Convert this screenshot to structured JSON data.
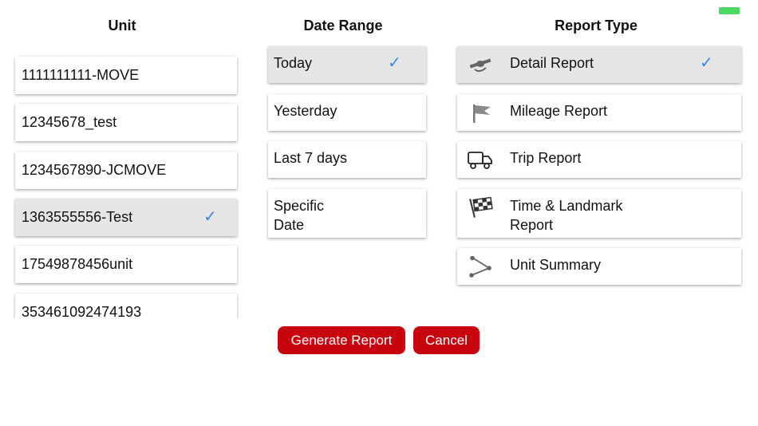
{
  "status": {
    "battery_color": "#4cd964"
  },
  "units": {
    "title": "Unit",
    "items": [
      {
        "label": "1111111111-MOVE",
        "selected": false
      },
      {
        "label": "12345678_test",
        "selected": false
      },
      {
        "label": "1234567890-JCMOVE",
        "selected": false
      },
      {
        "label": "1363555556-Test",
        "selected": true
      },
      {
        "label": "17549878456unit",
        "selected": false
      },
      {
        "label": "353461092474193",
        "selected": false
      }
    ]
  },
  "date_range": {
    "title": "Date Range",
    "items": [
      {
        "label": "Today",
        "selected": true
      },
      {
        "label": "Yesterday",
        "selected": false
      },
      {
        "label": "Last 7 days",
        "selected": false
      },
      {
        "label": "Specific\nDate",
        "selected": false
      }
    ]
  },
  "report_type": {
    "title": "Report Type",
    "items": [
      {
        "label": "Detail Report",
        "icon": "satellite-icon",
        "selected": true
      },
      {
        "label": "Mileage Report",
        "icon": "flag-icon",
        "selected": false
      },
      {
        "label": "Trip Report",
        "icon": "truck-icon",
        "selected": false
      },
      {
        "label": "Time & Landmark\nReport",
        "icon": "checkered-flag-icon",
        "selected": false
      },
      {
        "label": "Unit Summary",
        "icon": "share-icon",
        "selected": false
      }
    ]
  },
  "actions": {
    "generate": "Generate Report",
    "cancel": "Cancel"
  },
  "colors": {
    "accent": "#c8050f",
    "check": "#3a86e8",
    "selected_bg": "#e6e6e6"
  },
  "check_glyph": "✓"
}
